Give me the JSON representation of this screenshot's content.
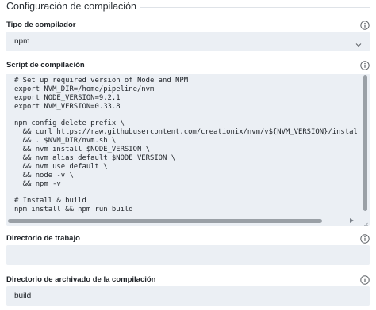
{
  "section": {
    "title": "Configuración de compilación"
  },
  "fields": {
    "compiler_type": {
      "label": "Tipo de compilador",
      "value": "npm"
    },
    "build_script": {
      "label": "Script de compilación",
      "lines": [
        "# Set up required version of Node and NPM",
        "export NVM_DIR=/home/pipeline/nvm",
        "export NODE_VERSION=9.2.1",
        "export NVM_VERSION=0.33.8",
        "",
        "npm config delete prefix \\",
        "  && curl https://raw.githubusercontent.com/creationix/nvm/v${NVM_VERSION}/install.sh | sh \\",
        "  && . $NVM_DIR/nvm.sh \\",
        "  && nvm install $NODE_VERSION \\",
        "  && nvm alias default $NODE_VERSION \\",
        "  && nvm use default \\",
        "  && node -v \\",
        "  && npm -v",
        "",
        "# Install & build",
        "npm install && npm run build"
      ]
    },
    "working_directory": {
      "label": "Directorio de trabajo",
      "value": ""
    },
    "archive_directory": {
      "label": "Directorio de archivado de la compilación",
      "value": "build"
    }
  },
  "icons": {
    "info": "info-icon",
    "dropdown": "chevron-down-icon",
    "resize": "resize-grip-icon"
  },
  "colors": {
    "field_background": "#ebeff4",
    "scrollbar_thumb": "#9aa0a6",
    "divider": "#dfe3e8"
  }
}
